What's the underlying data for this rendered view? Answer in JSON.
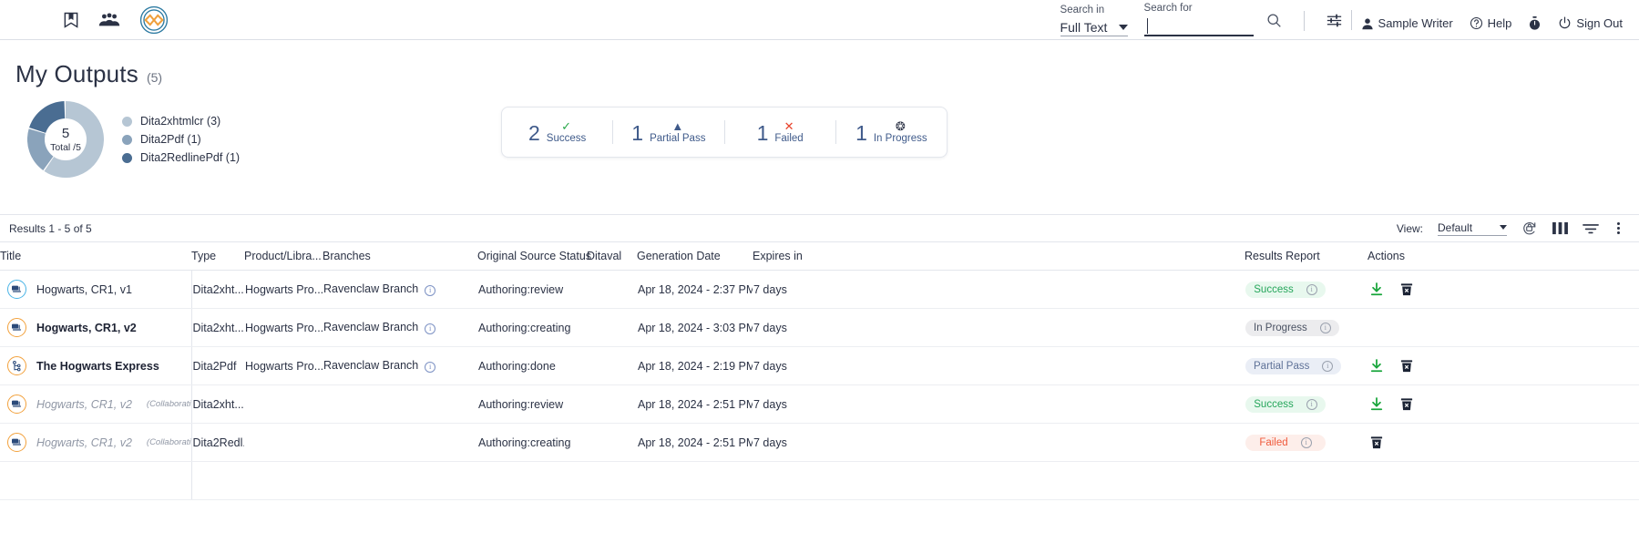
{
  "header": {
    "icons": [
      "hamburger-menu-icon",
      "bookmark-icon",
      "people-icon",
      "brand-logo-icon"
    ],
    "search_in_label": "Search in",
    "search_in_value": "Full Text",
    "search_for_label": "Search for",
    "search_for_value": "",
    "search_for_placeholder": "",
    "search_icon": "search-icon",
    "settings_icon": "filter-settings-icon",
    "user_name": "Sample Writer",
    "help_label": "Help",
    "timer_icon": "stopwatch-icon",
    "sign_out_label": "Sign Out"
  },
  "page": {
    "title": "My Outputs",
    "count": "(5)"
  },
  "chart_data": {
    "type": "pie",
    "title": "My Outputs",
    "center_value": "5",
    "center_label": "Total /5",
    "total": 5,
    "categories": [
      "Dita2xhtmlcr",
      "Dita2Pdf",
      "Dita2RedlinePdf"
    ],
    "values": [
      3,
      1,
      1
    ],
    "colors": [
      "#b6c6d4",
      "#8aa3bb",
      "#4a6d92"
    ],
    "legend": [
      {
        "label": "Dita2xhtmlcr (3)",
        "color": "#b6c6d4"
      },
      {
        "label": "Dita2Pdf (1)",
        "color": "#8aa3bb"
      },
      {
        "label": "Dita2RedlinePdf (1)",
        "color": "#4a6d92"
      }
    ],
    "legend_position": "right",
    "grid": false
  },
  "status_summary": [
    {
      "count": "2",
      "label": "Success",
      "icon": "check-icon",
      "glyph": "✓",
      "color": "#2aa84a"
    },
    {
      "count": "1",
      "label": "Partial Pass",
      "icon": "triangle-icon",
      "glyph": "▲",
      "color": "#3f5a8a"
    },
    {
      "count": "1",
      "label": "Failed",
      "icon": "cross-icon",
      "glyph": "✕",
      "color": "#e8432c"
    },
    {
      "count": "1",
      "label": "In Progress",
      "icon": "clock-icon",
      "glyph": "❂",
      "color": "#2b3245"
    }
  ],
  "toolbar": {
    "results_text": "Results 1 - 5 of 5",
    "view_label": "View:",
    "view_value": "Default",
    "refresh_icon": "refresh-lock-icon",
    "columns_icon": "columns-icon",
    "filter_icon": "filter-icon",
    "more_icon": "kebab-menu-icon"
  },
  "table": {
    "columns": [
      "Title",
      "Type",
      "Product/Libra...",
      "Branches",
      "Original Source Status",
      "Ditaval",
      "Generation Date",
      "Expires in",
      "Results Report",
      "Actions"
    ],
    "rows": [
      {
        "icon": "document-output-icon",
        "icon_color": "blue",
        "title": "Hogwarts, CR1, v1",
        "title_note": "",
        "style": "normal",
        "type": "Dita2xht...",
        "product": "Hogwarts Pro...",
        "branch": "Ravenclaw Branch",
        "source_status": "Authoring:review",
        "ditaval": "",
        "generation_date": "Apr 18, 2024 - 2:37 PM",
        "expires": "7 days",
        "report": "Success",
        "report_kind": "success",
        "actions": [
          "download-icon",
          "delete-icon"
        ]
      },
      {
        "icon": "document-output-icon",
        "icon_color": "orange",
        "title": "Hogwarts, CR1, v2",
        "title_note": "",
        "style": "bold",
        "type": "Dita2xht...",
        "product": "Hogwarts Pro...",
        "branch": "Ravenclaw Branch",
        "source_status": "Authoring:creating",
        "ditaval": "",
        "generation_date": "Apr 18, 2024 - 3:03 PM",
        "expires": "7 days",
        "report": "In Progress",
        "report_kind": "progress",
        "actions": []
      },
      {
        "icon": "map-branch-icon",
        "icon_color": "orange",
        "title": "The Hogwarts Express",
        "title_note": "",
        "style": "bold",
        "type": "Dita2Pdf",
        "product": "Hogwarts Pro...",
        "branch": "Ravenclaw Branch",
        "source_status": "Authoring:done",
        "ditaval": "",
        "generation_date": "Apr 18, 2024 - 2:19 PM",
        "expires": "7 days",
        "report": "Partial Pass",
        "report_kind": "partial",
        "actions": [
          "download-icon",
          "delete-icon"
        ]
      },
      {
        "icon": "document-output-icon",
        "icon_color": "orange",
        "title": "Hogwarts, CR1, v2",
        "title_note": "(Collaborative R",
        "style": "dim",
        "type": "Dita2xht...",
        "product": "",
        "branch": "",
        "source_status": "Authoring:review",
        "ditaval": "",
        "generation_date": "Apr 18, 2024 - 2:51 PM",
        "expires": "7 days",
        "report": "Success",
        "report_kind": "success",
        "actions": [
          "download-icon",
          "delete-icon"
        ]
      },
      {
        "icon": "document-output-icon",
        "icon_color": "orange",
        "title": "Hogwarts, CR1, v2",
        "title_note": "(Collaborative R",
        "style": "dim",
        "type": "Dita2Redl...",
        "product": "",
        "branch": "",
        "source_status": "Authoring:creating",
        "ditaval": "",
        "generation_date": "Apr 18, 2024 - 2:51 PM",
        "expires": "7 days",
        "report": "Failed",
        "report_kind": "failed",
        "actions": [
          "delete-icon"
        ]
      }
    ]
  }
}
